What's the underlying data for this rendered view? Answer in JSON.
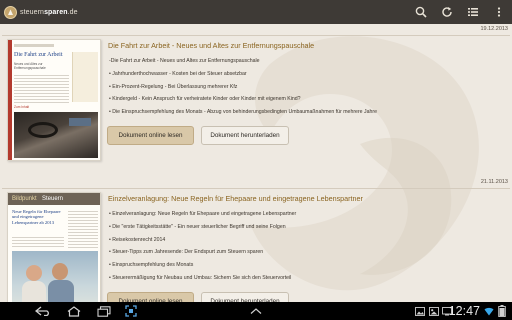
{
  "app": {
    "logo_prefix": "steuern",
    "logo_bold": "sparen",
    "logo_suffix": ".de"
  },
  "action_bar": {
    "icons": [
      "search-icon",
      "refresh-icon",
      "list-icon",
      "overflow-menu-icon"
    ]
  },
  "documents": [
    {
      "date": "19.12.2013",
      "title": "Die Fahrt zur Arbeit - Neues und Altes zur Entfernungspauschale",
      "bullets": [
        "-Die Fahrt zur Arbeit - Neues und Altes zur Entfernungspauschale",
        "• Jahrhunderthochwasser - Kosten bei der Steuer absetzbar",
        "• Ein-Prozent-Regelung - Bei Überlassung mehrerer Kfz",
        "• Kindergeld - Kein Anspruch für verheiratete Kinder oder Kinder mit eigenem Kind?",
        "• Die Einspruchsempfehlung des Monats - Abzug von behinderungsbedingten Umbaumaßnahmen für mehrere Jahre"
      ],
      "thumbnail": {
        "heading": "Die Fahrt zur Arbeit",
        "sub": "Neues und Altes zur Entfernungspauschale",
        "section": "Zum Inhalt"
      },
      "read_label": "Dokument online lesen",
      "download_label": "Dokument herunterladen"
    },
    {
      "date": "21.11.2013",
      "title": "Einzelveranlagung: Neue Regeln für Ehepaare und eingetragene Lebenspartner",
      "bullets": [
        "• Einzelveranlagung: Neue Regeln für Ehepaare und eingetragene Lebenspartner",
        "• Die \"erste Tätigkeitsstätte\" - Ein neuer steuerlicher Begriff und seine Folgen",
        "• Reisekostenrecht 2014",
        "• Steuer-Tipps zum Jahresende: Der Endspurt zum Steuern sparen",
        "• Einspruchsempfehlung des Monats",
        "• Steuerermäßigung für Neubau und Umbau: Sichern Sie sich den Steuervorteil"
      ],
      "thumbnail": {
        "header_prefix": "Bildpunkt",
        "header_suffix": "Steuern",
        "heading": "Neue Regeln für Ehepaare und eingetragene Lebenspartner ab 2013"
      },
      "read_label": "Dokument online lesen",
      "download_label": "Dokument herunterladen"
    }
  ],
  "status_bar": {
    "time": "12:47",
    "nav_icons": [
      "back-icon",
      "home-icon",
      "recent-apps-icon",
      "screenshot-icon",
      "up-chevron-icon"
    ]
  },
  "colors": {
    "action_bar": "#3e3a36",
    "background": "#eee9e1",
    "title": "#8a6420",
    "primary_button": "#d9c8a8"
  }
}
